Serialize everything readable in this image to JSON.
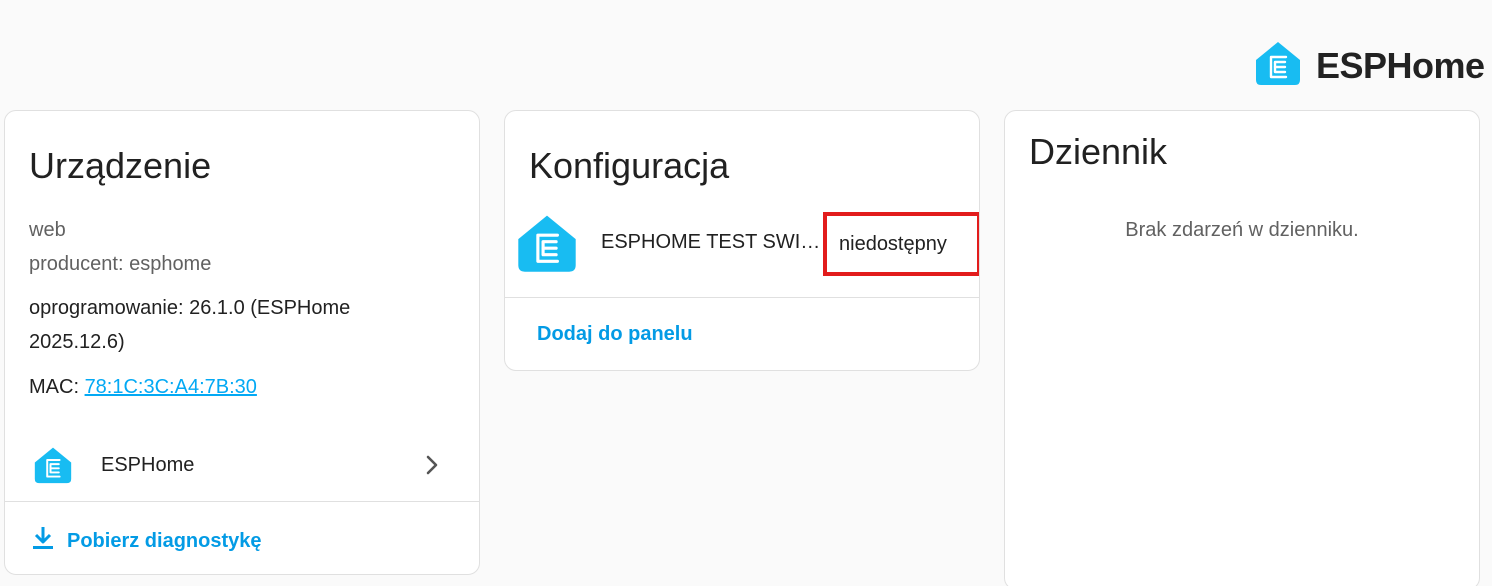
{
  "brand": {
    "name": "ESPHome",
    "logo_icon": "esphome-logo-icon",
    "color": "#18bcf2"
  },
  "device_card": {
    "title": "Urządzenie",
    "model": "web",
    "manufacturer": "producent: esphome",
    "firmware": "oprogramowanie: 26.1.0 (ESPHome",
    "firmware_cont": "2025.12.6)",
    "mac_label": "MAC: ",
    "mac_value": "78:1C:3C:A4:7B:30",
    "integration": {
      "label": "ESPHome",
      "icon": "esphome-logo-icon",
      "chevron_icon": "chevron-right-icon"
    },
    "download_button": {
      "label": "Pobierz diagnostykę",
      "icon": "download-icon"
    }
  },
  "config_card": {
    "title": "Konfiguracja",
    "entity": {
      "name": "ESPHOME TEST SWIT…",
      "state": "niedostępny",
      "icon": "esphome-logo-icon"
    },
    "add_to_panel": "Dodaj do panelu"
  },
  "log_card": {
    "title": "Dziennik",
    "empty_message": "Brak zdarzeń w dzienniku."
  },
  "colors": {
    "accent": "#039be5",
    "highlight_border": "#e21c1c",
    "card_border": "#e0e0e0",
    "background": "#fafafa"
  }
}
